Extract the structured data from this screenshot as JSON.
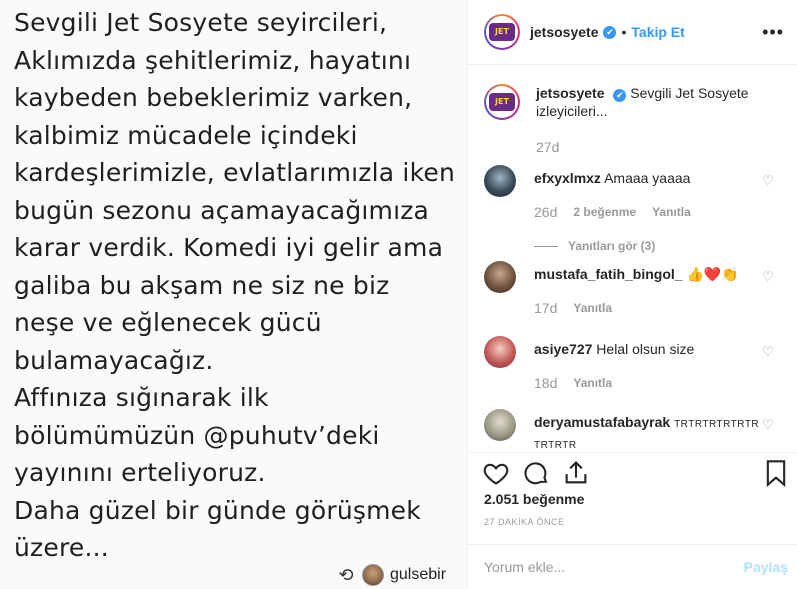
{
  "post_image": {
    "lines": [
      "Sevgili Jet Sosyete seyircileri,",
      "Aklımızda şehitlerimiz, hayatını",
      "kaybeden bebeklerimiz varken,",
      "kalbimiz mücadele içindeki",
      "kardeşlerimizle, evlatlarımızla iken",
      "bugün sezonu açamayacağımıza",
      "karar verdik. Komedi iyi gelir ama",
      "galiba bu akşam ne siz ne biz",
      "neşe ve eğlenecek gücü",
      "bulamayacağız.",
      "Affınıza sığınarak ilk",
      "bölümümüzün @puhutv’deki",
      "yayınını erteliyoruz.",
      "Daha güzel bir günde görüşmek",
      "üzere..."
    ],
    "repost_icon": "⟲",
    "repost_user": "gulsebir"
  },
  "header": {
    "logo_text": "JET",
    "username": "jetsosyete",
    "verified_icon": "✔",
    "separator": "•",
    "follow_label": "Takip Et",
    "more_icon": "•••"
  },
  "caption": {
    "username": "jetsosyete",
    "text": "Sevgili Jet Sosyete izleyicileri...",
    "time": "27d"
  },
  "comments": [
    {
      "username": "efxyxlmxz",
      "text": "Amaaa yaaaa",
      "time": "26d",
      "likes": "2 beğenme",
      "reply": "Yanıtla",
      "replies": "Yanıtları gör (3)"
    },
    {
      "username": "mustafa_fatih_bingol_",
      "text": "👍❤️👏",
      "time": "17d",
      "reply": "Yanıtla"
    },
    {
      "username": "asiye727",
      "text": "Helal olsun size",
      "time": "18d",
      "reply": "Yanıtla"
    },
    {
      "username": "deryamustafabayrak",
      "text": "TRTRTRTRTRTR TRTRTR"
    }
  ],
  "actions": {
    "heart_icon": "heart-icon",
    "comment_icon": "comment-icon",
    "share_icon": "share-icon",
    "bookmark_icon": "bookmark-icon"
  },
  "likes": "2.051 beğenme",
  "timestamp": "27 DAKİKA ÖNCE",
  "comment_box": {
    "placeholder": "Yorum ekle...",
    "post_label": "Paylaş"
  },
  "colors": {
    "accent": "#3897f0",
    "muted": "#999999",
    "post_disabled": "#b2dffc"
  }
}
